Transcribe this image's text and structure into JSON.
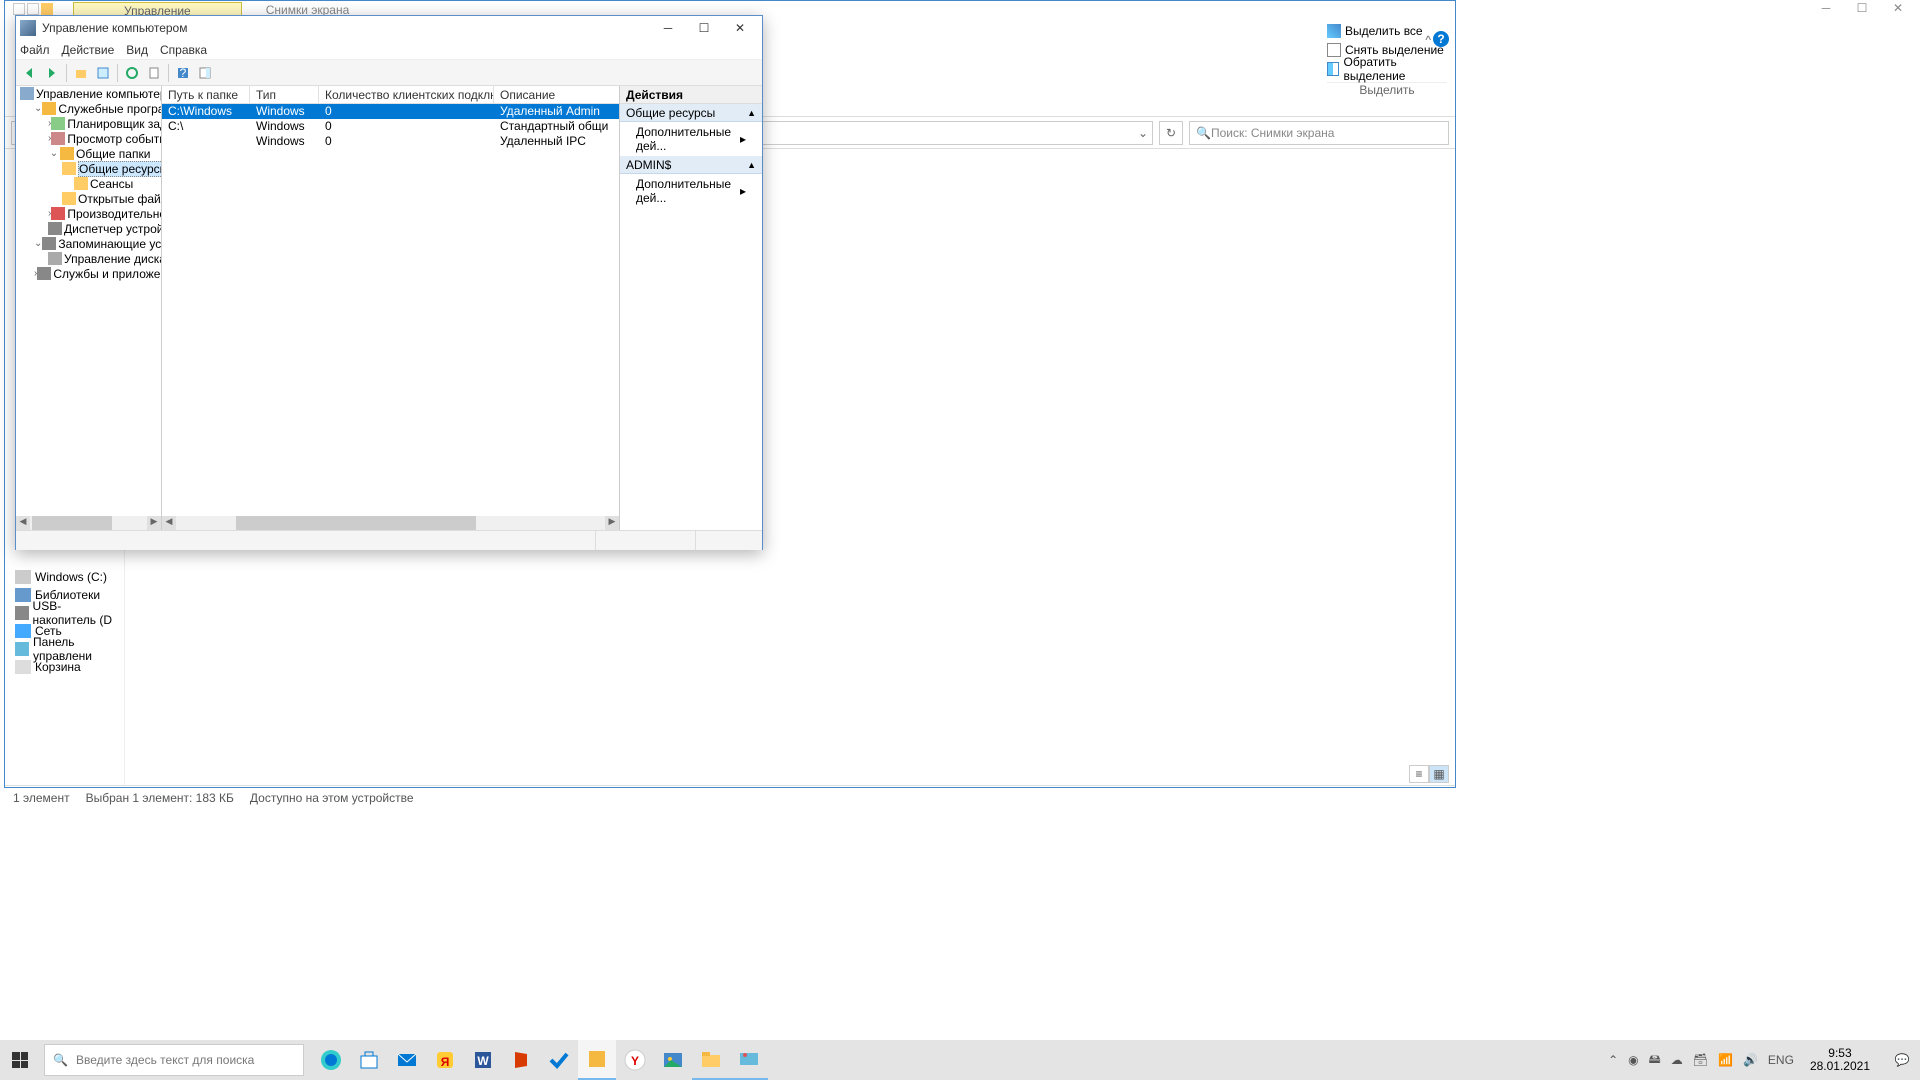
{
  "explorer": {
    "tabs": [
      "Управление",
      "Снимки экрана"
    ],
    "ribbon": {
      "select_all": "Выделить все",
      "select_none": "Снять выделение",
      "invert": "Обратить выделение",
      "section": "Выделить"
    },
    "search_placeholder": "Поиск: Снимки экрана",
    "nav": {
      "windows": "Windows (C:)",
      "libraries": "Библиотеки",
      "usb": "USB-накопитель (D",
      "network": "Сеть",
      "cpanel": "Панель управлени",
      "recycle": "Корзина"
    },
    "status": {
      "count": "1 элемент",
      "selected": "Выбран 1 элемент: 183 КБ",
      "avail": "Доступно на этом устройстве"
    }
  },
  "mmc": {
    "title": "Управление компьютером",
    "menus": [
      "Файл",
      "Действие",
      "Вид",
      "Справка"
    ],
    "tree": [
      {
        "lvl": 0,
        "exp": "",
        "label": "Управление компьютером (л",
        "icon": "comp"
      },
      {
        "lvl": 1,
        "exp": "v",
        "label": "Служебные программы",
        "icon": "tools"
      },
      {
        "lvl": 2,
        "exp": ">",
        "label": "Планировщик заданий",
        "icon": "sched"
      },
      {
        "lvl": 2,
        "exp": ">",
        "label": "Просмотр событий",
        "icon": "event"
      },
      {
        "lvl": 2,
        "exp": "v",
        "label": "Общие папки",
        "icon": "shared"
      },
      {
        "lvl": 3,
        "exp": "",
        "label": "Общие ресурсы",
        "icon": "shares",
        "sel": true
      },
      {
        "lvl": 3,
        "exp": "",
        "label": "Сеансы",
        "icon": "sessions"
      },
      {
        "lvl": 3,
        "exp": "",
        "label": "Открытые файлы",
        "icon": "openf"
      },
      {
        "lvl": 2,
        "exp": ">",
        "label": "Производительность",
        "icon": "perf"
      },
      {
        "lvl": 2,
        "exp": "",
        "label": "Диспетчер устройств",
        "icon": "devmgr"
      },
      {
        "lvl": 1,
        "exp": "v",
        "label": "Запоминающие устройств",
        "icon": "storage"
      },
      {
        "lvl": 2,
        "exp": "",
        "label": "Управление дисками",
        "icon": "diskmgr"
      },
      {
        "lvl": 1,
        "exp": ">",
        "label": "Службы и приложения",
        "icon": "services"
      }
    ],
    "columns": [
      "Путь к папке",
      "Тип",
      "Количество клиентских подключений",
      "Описание"
    ],
    "rows": [
      {
        "path": "C:\\Windows",
        "type": "Windows",
        "conn": "0",
        "desc": "Удаленный Admin",
        "sel": true
      },
      {
        "path": "C:\\",
        "type": "Windows",
        "conn": "0",
        "desc": "Стандартный общий р..."
      },
      {
        "path": "",
        "type": "Windows",
        "conn": "0",
        "desc": "Удаленный IPC"
      }
    ],
    "actions": {
      "header": "Действия",
      "group1": "Общие ресурсы",
      "item1": "Дополнительные дей...",
      "group2": "ADMIN$",
      "item2": "Дополнительные дей..."
    }
  },
  "taskbar": {
    "search": "Введите здесь текст для поиска",
    "lang": "ENG",
    "time": "9:53",
    "date": "28.01.2021"
  }
}
